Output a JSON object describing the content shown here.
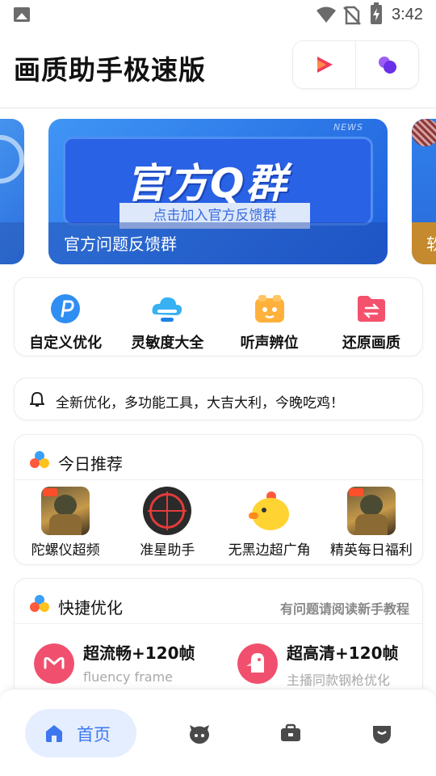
{
  "status_bar": {
    "time": "3:42",
    "icons": [
      "image-icon",
      "wifi-icon",
      "no-sim-icon",
      "battery-charging-icon"
    ]
  },
  "header": {
    "title": "画质助手极速版",
    "actions": [
      "video-play-icon",
      "bubbles-icon"
    ],
    "colors": {
      "play": "#f23b5c",
      "bubbles": "#7c3ff2"
    }
  },
  "banner": {
    "news_tag": "NEWS",
    "headline": "官方Q群",
    "pill_text": "点击加入官方反馈群",
    "caption": "官方问题反馈群",
    "right_peek_caption": "软",
    "accent": "#2a62e6"
  },
  "tools": [
    {
      "label": "自定义优化",
      "icon": "custom-optimize-icon",
      "color": "#2f8ef2"
    },
    {
      "label": "灵敏度大全",
      "icon": "sensitivity-icon",
      "color": "#2fa8f0"
    },
    {
      "label": "听声辨位",
      "icon": "sound-locate-icon",
      "color": "#ffb13b"
    },
    {
      "label": "还原画质",
      "icon": "restore-quality-icon",
      "color": "#f4516c"
    }
  ],
  "notice": {
    "text": "全新优化，多功能工具，大吉大利，今晚吃鸡！",
    "icon": "bell-icon"
  },
  "recommend": {
    "title": "今日推荐",
    "items": [
      {
        "label": "陀螺仪超频",
        "thumb": "game-cover"
      },
      {
        "label": "准星助手",
        "thumb": "crosshair-icon"
      },
      {
        "label": "无黑边超广角",
        "thumb": "chick-icon"
      },
      {
        "label": "精英每日福利",
        "thumb": "game-cover"
      }
    ]
  },
  "quick": {
    "title": "快捷优化",
    "help_link": "有问题请阅读新手教程",
    "items": [
      {
        "title": "超流畅+120帧",
        "subtitle": "fluency frame",
        "color": "#f0506e"
      },
      {
        "title": "超高清+120帧",
        "subtitle": "主播同款钢枪优化",
        "color": "#f0506e"
      }
    ]
  },
  "bottom_nav": {
    "home_label": "首页",
    "active_color": "#3d77f0",
    "items": [
      "home-icon",
      "game-face-icon",
      "toolbox-icon",
      "shield-icon"
    ]
  }
}
